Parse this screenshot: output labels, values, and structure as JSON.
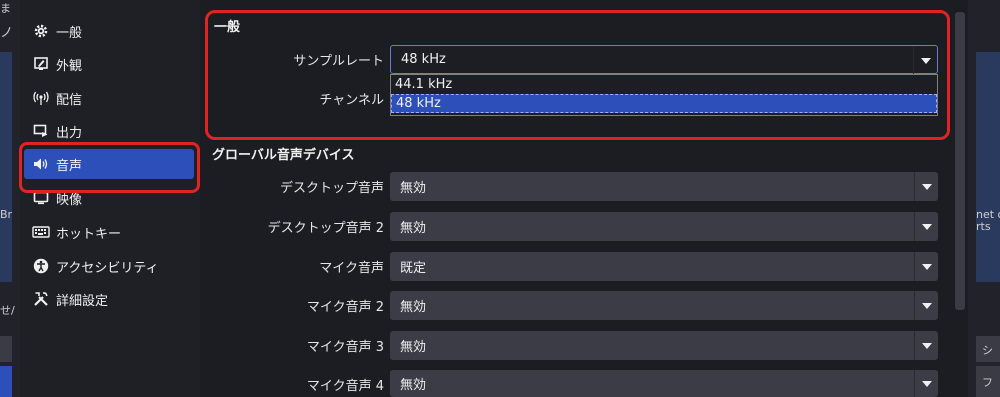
{
  "background_fragments": {
    "left_top": "ま",
    "left_second": "ノ",
    "left_mid": "Br",
    "left_low": "せ/",
    "right_mid_1": "net o",
    "right_mid_2": "rts",
    "right_bottom_1": "シ",
    "right_bottom_2": "フ"
  },
  "sidebar": {
    "items": [
      {
        "label": "一般",
        "icon": "gear-icon"
      },
      {
        "label": "外観",
        "icon": "appearance-icon"
      },
      {
        "label": "配信",
        "icon": "broadcast-icon"
      },
      {
        "label": "出力",
        "icon": "output-icon"
      },
      {
        "label": "音声",
        "icon": "speaker-icon",
        "active": true
      },
      {
        "label": "映像",
        "icon": "monitor-icon"
      },
      {
        "label": "ホットキー",
        "icon": "keyboard-icon"
      },
      {
        "label": "アクセシビリティ",
        "icon": "accessibility-icon"
      },
      {
        "label": "詳細設定",
        "icon": "tools-icon"
      }
    ]
  },
  "general": {
    "title": "一般",
    "sample_rate_label": "サンプルレート",
    "sample_rate_value": "48 kHz",
    "channel_label": "チャンネル",
    "sample_rate_options": [
      "44.1 kHz",
      "48 kHz"
    ],
    "selected_option": "48 kHz"
  },
  "global_audio": {
    "title": "グローバル音声デバイス",
    "rows": [
      {
        "label": "デスクトップ音声",
        "value": "無効"
      },
      {
        "label": "デスクトップ音声 2",
        "value": "無効"
      },
      {
        "label": "マイク音声",
        "value": "既定"
      },
      {
        "label": "マイク音声 2",
        "value": "無効"
      },
      {
        "label": "マイク音声 3",
        "value": "無効"
      },
      {
        "label": "マイク音声 4",
        "value": "無効"
      }
    ]
  },
  "colors": {
    "accent": "#2d4fb9",
    "highlight": "#e02424",
    "background": "#1c1d23"
  }
}
